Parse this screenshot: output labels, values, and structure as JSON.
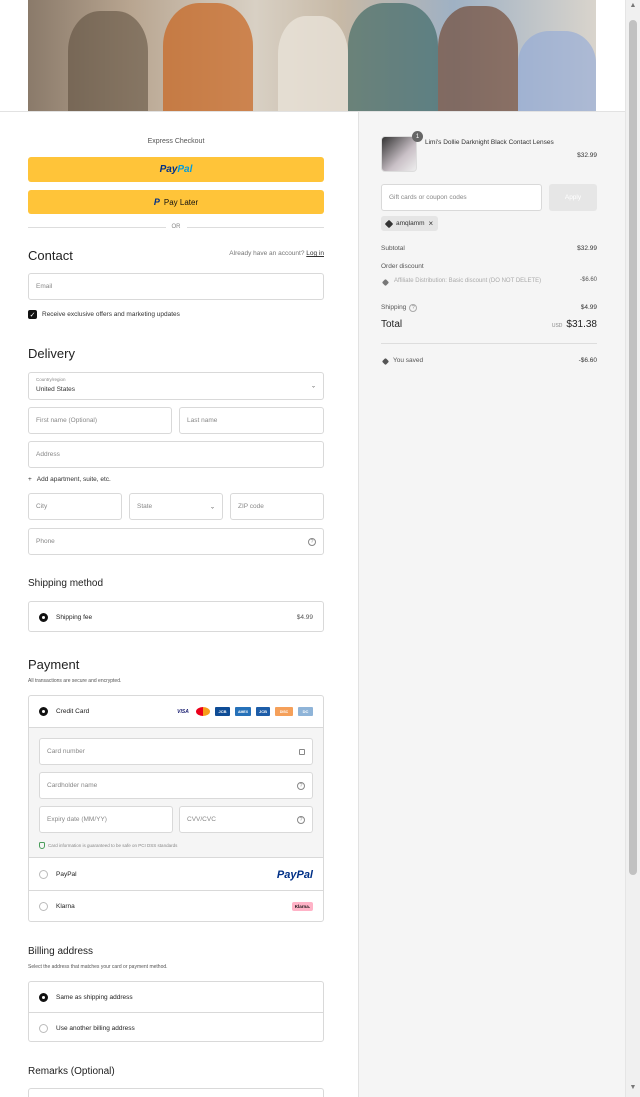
{
  "express": {
    "title": "Express Checkout",
    "paypal_a": "Pay",
    "paypal_b": "Pal",
    "pay_later": "Pay Later",
    "or": "OR"
  },
  "contact": {
    "heading": "Contact",
    "have_account": "Already have an account?",
    "login": "Log in",
    "email_placeholder": "Email",
    "offers": "Receive exclusive offers and marketing updates"
  },
  "delivery": {
    "heading": "Delivery",
    "country_label": "Country/region",
    "country_value": "United States",
    "first_name": "First name (Optional)",
    "last_name": "Last name",
    "address": "Address",
    "add_apartment": "Add apartment, suite, etc.",
    "city": "City",
    "state": "State",
    "zip": "ZIP code",
    "phone": "Phone"
  },
  "shipping": {
    "heading": "Shipping method",
    "option": "Shipping fee",
    "price": "$4.99"
  },
  "payment": {
    "heading": "Payment",
    "subtitle": "All transactions are secure and encrypted.",
    "credit_card": "Credit Card",
    "card_brands": [
      "VISA",
      "MC",
      "JCB",
      "AMEX",
      "JCB",
      "DISC",
      "DC"
    ],
    "card_number": "Card number",
    "cardholder": "Cardholder name",
    "expiry": "Expiry date (MM/YY)",
    "cvv": "CVV/CVC",
    "secure_note": "Card information is guaranteed to be safe on PCI DSS standards",
    "paypal": "PayPal",
    "paypal_logo": "PayPal",
    "klarna": "Klarna",
    "klarna_logo": "Klarna."
  },
  "billing": {
    "heading": "Billing address",
    "subtitle": "Select the address that matches your card or payment method.",
    "same": "Same as shipping address",
    "other": "Use another billing address"
  },
  "remarks": {
    "heading": "Remarks (Optional)"
  },
  "summary": {
    "qty": "1",
    "product_name": "Limi's Dollie Darknight Black Contact Lenses",
    "product_price": "$32.99",
    "coupon_placeholder": "Gift cards or coupon codes",
    "apply": "Apply",
    "coupon_tag": "amqlamm",
    "subtotal_label": "Subtotal",
    "subtotal_value": "$32.99",
    "order_discount_label": "Order discount",
    "discount_name": "Affiliate Distribution: Basic discount (DO NOT DELETE)",
    "discount_value": "-$6.60",
    "shipping_label": "Shipping",
    "shipping_value": "$4.99",
    "total_label": "Total",
    "total_currency": "USD",
    "total_value": "$31.38",
    "saved_label": "You saved",
    "saved_value": "-$6.60"
  }
}
